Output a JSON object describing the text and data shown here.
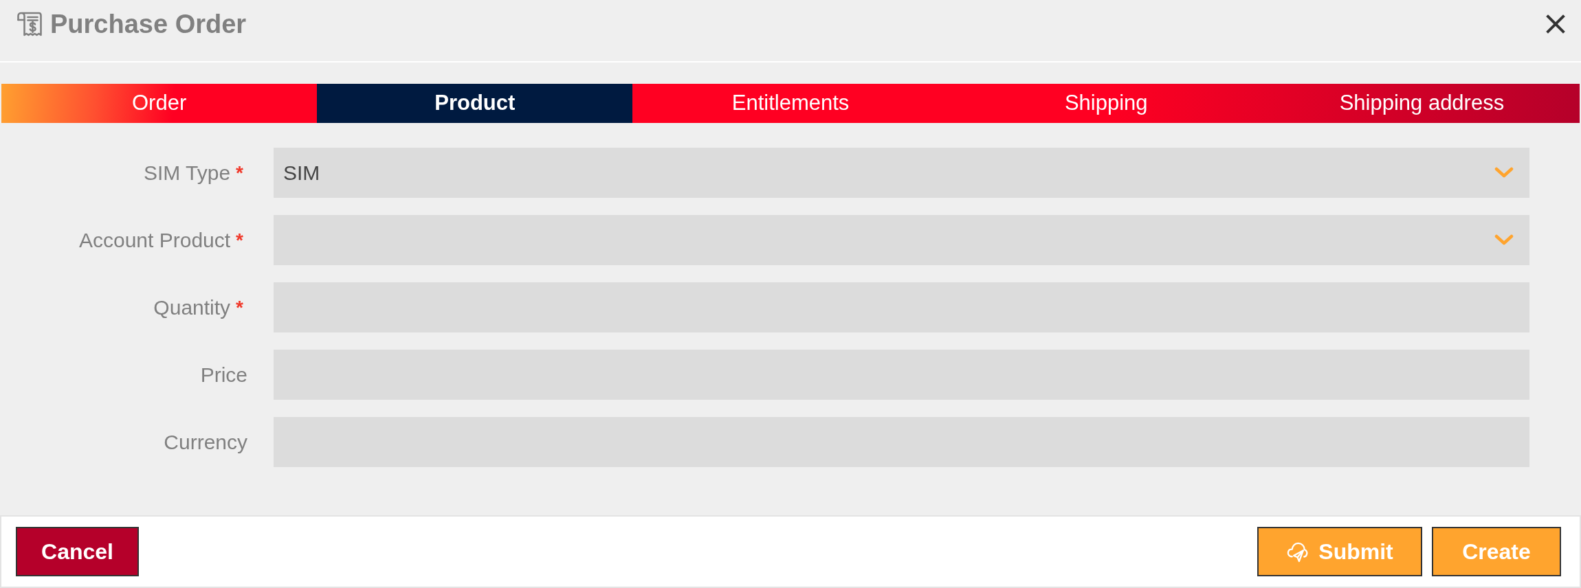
{
  "window": {
    "title": "Purchase Order"
  },
  "tabs": [
    {
      "label": "Order",
      "selected": false
    },
    {
      "label": "Product",
      "selected": true
    },
    {
      "label": "Entitlements",
      "selected": false
    },
    {
      "label": "Shipping",
      "selected": false
    },
    {
      "label": "Shipping address",
      "selected": false
    }
  ],
  "form": {
    "fields": [
      {
        "label": "SIM Type",
        "required_mark": "*",
        "kind": "select",
        "value": "SIM"
      },
      {
        "label": "Account Product",
        "required_mark": "*",
        "kind": "select"
      },
      {
        "label": "Quantity",
        "required_mark": "*",
        "kind": "text"
      },
      {
        "label": "Price",
        "kind": "text"
      },
      {
        "label": "Currency",
        "kind": "text"
      }
    ]
  },
  "footer": {
    "left_buttons": [
      {
        "label": "Cancel",
        "kind": "danger"
      }
    ],
    "right_buttons": [
      {
        "label": "Submit",
        "kind": "send"
      },
      {
        "label": "Create",
        "kind": "primary"
      }
    ]
  }
}
